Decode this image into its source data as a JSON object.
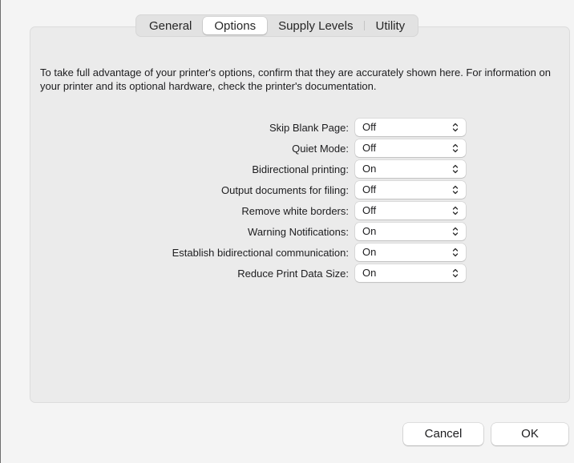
{
  "tabs": [
    {
      "label": "General",
      "selected": false
    },
    {
      "label": "Options",
      "selected": true
    },
    {
      "label": "Supply Levels",
      "selected": false
    },
    {
      "label": "Utility",
      "selected": false
    }
  ],
  "description": "To take full advantage of your printer's options, confirm that they are accurately shown here. For information on your printer and its optional hardware, check the printer's documentation.",
  "options": [
    {
      "label": "Skip Blank Page:",
      "value": "Off"
    },
    {
      "label": "Quiet Mode:",
      "value": "Off"
    },
    {
      "label": "Bidirectional printing:",
      "value": "On"
    },
    {
      "label": "Output documents for filing:",
      "value": "Off"
    },
    {
      "label": "Remove white borders:",
      "value": "Off"
    },
    {
      "label": "Warning Notifications:",
      "value": "On"
    },
    {
      "label": "Establish bidirectional communication:",
      "value": "On"
    },
    {
      "label": "Reduce Print Data Size:",
      "value": "On"
    }
  ],
  "buttons": {
    "cancel": "Cancel",
    "ok": "OK"
  },
  "icons": {
    "popup_chevron": "up-down-chevron-icon"
  }
}
